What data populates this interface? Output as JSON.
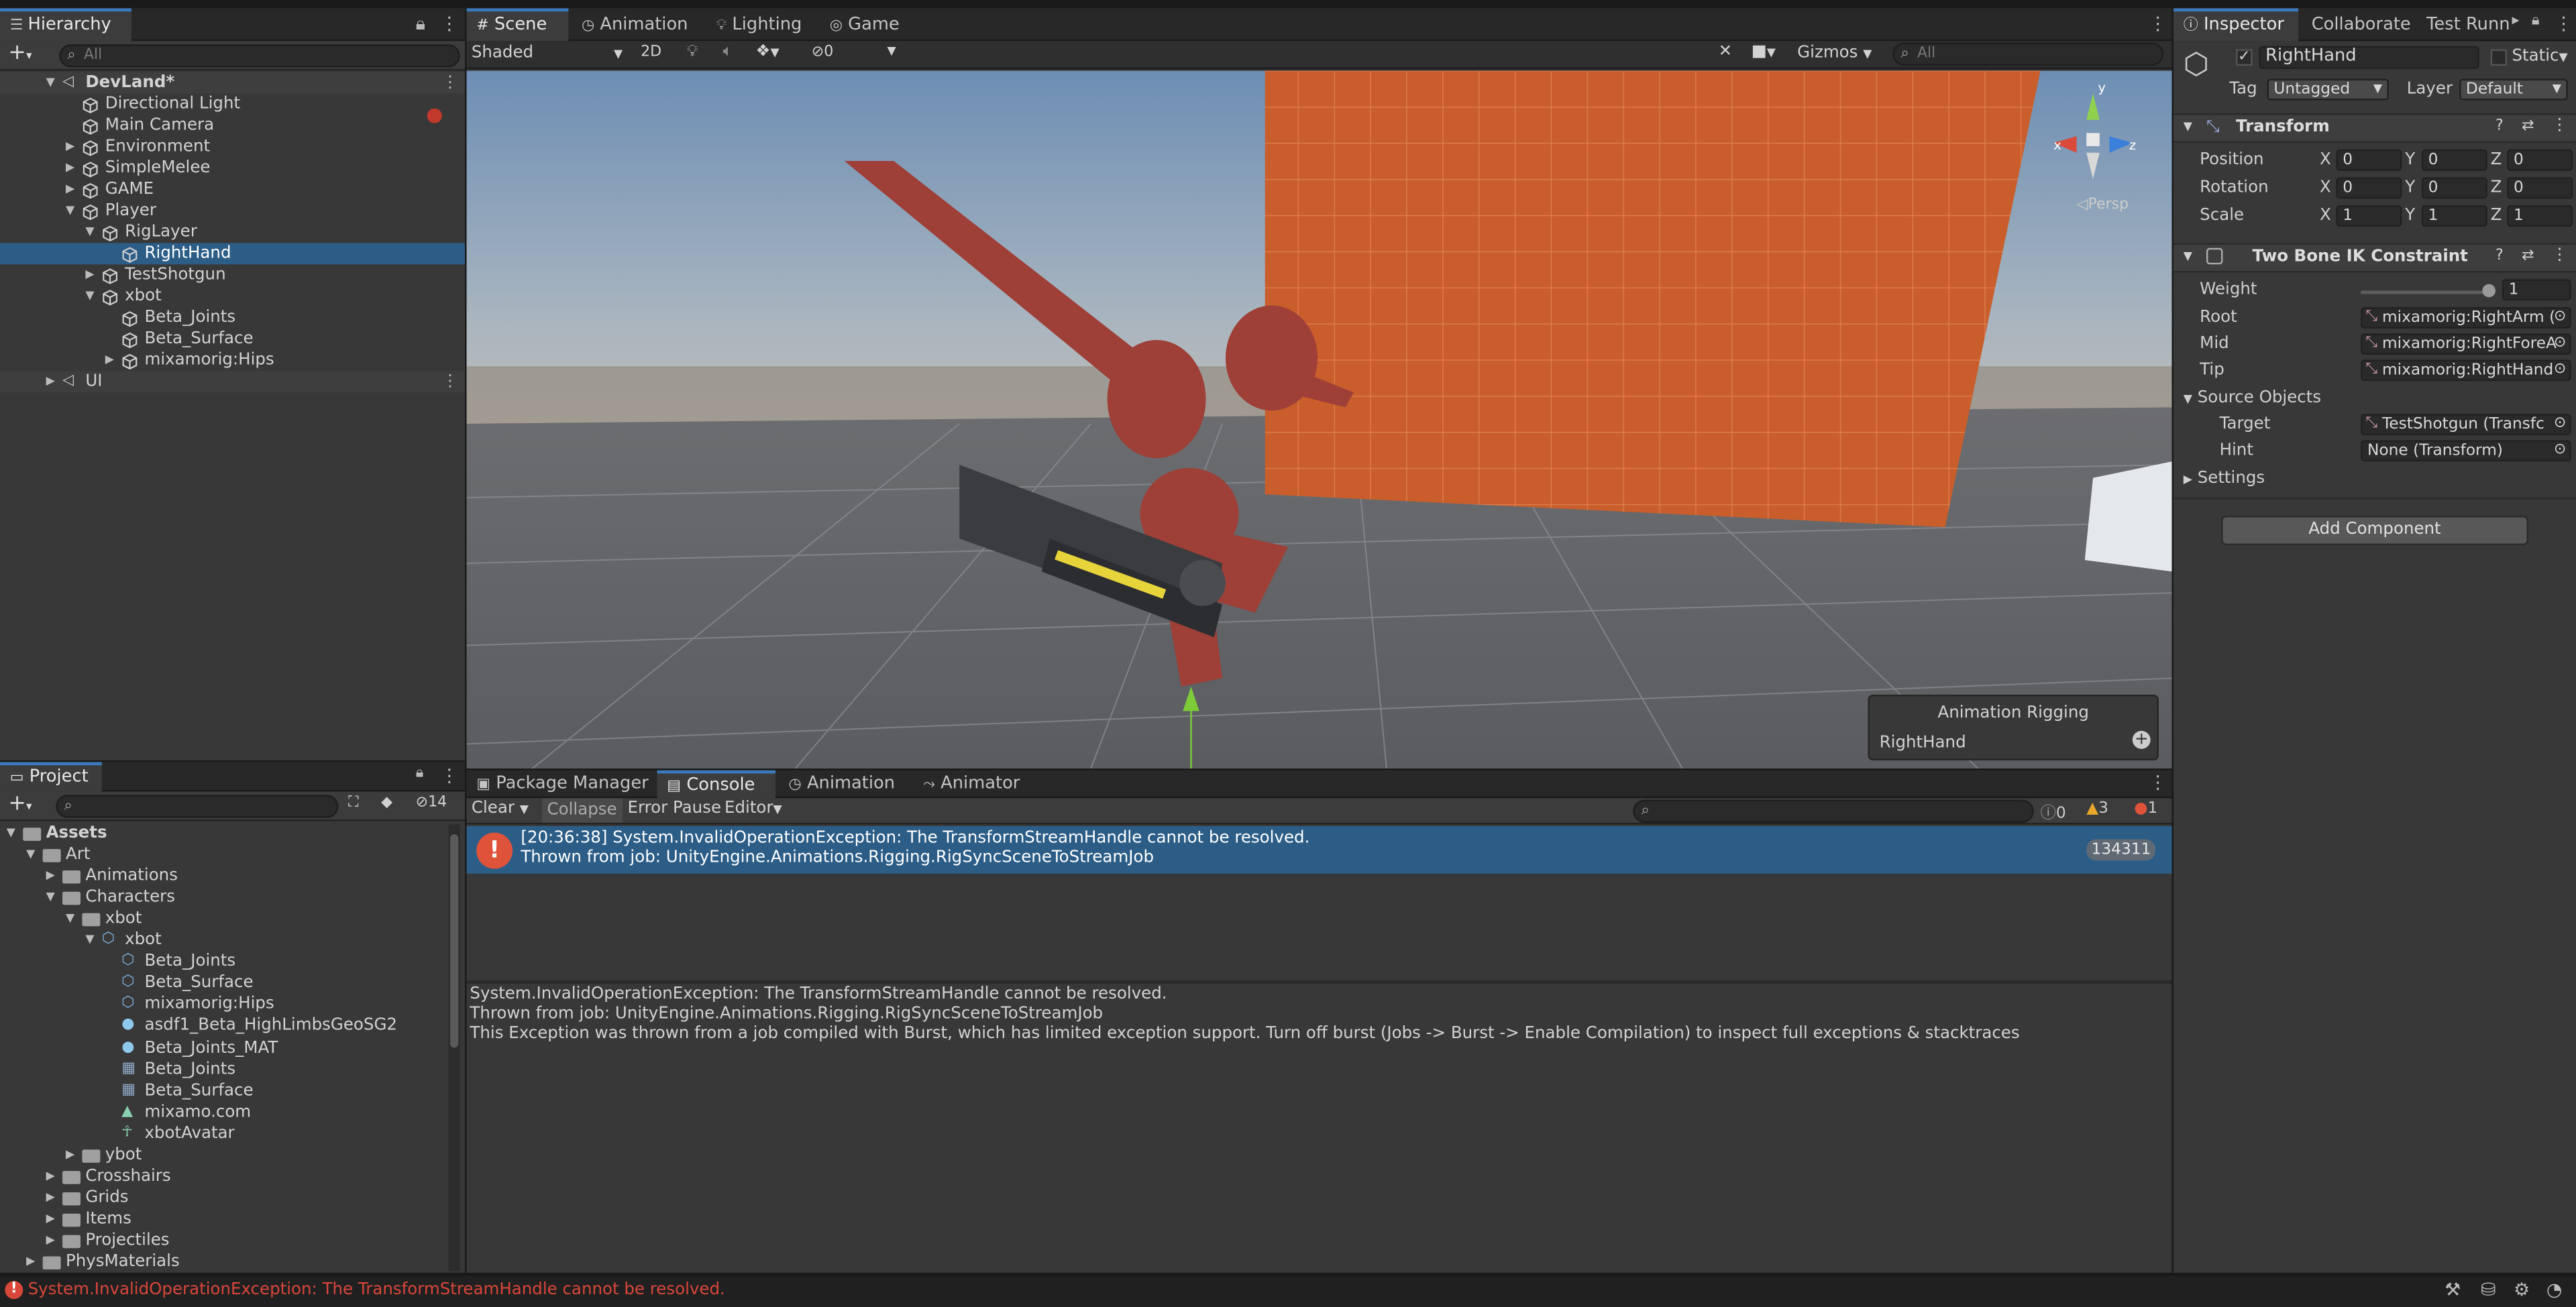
{
  "hierarchy": {
    "tab": "Hierarchy",
    "search_placeholder": "All",
    "scene": "DevLand*",
    "items": [
      {
        "label": "Directional Light",
        "depth": 1,
        "arrow": ""
      },
      {
        "label": "Main Camera",
        "depth": 1,
        "arrow": ""
      },
      {
        "label": "Environment",
        "depth": 1,
        "arrow": "▶"
      },
      {
        "label": "SimpleMelee",
        "depth": 1,
        "arrow": "▶"
      },
      {
        "label": "GAME",
        "depth": 1,
        "arrow": "▶"
      },
      {
        "label": "Player",
        "depth": 1,
        "arrow": "▼"
      },
      {
        "label": "RigLayer",
        "depth": 2,
        "arrow": "▼"
      },
      {
        "label": "RightHand",
        "depth": 3,
        "arrow": ""
      },
      {
        "label": "TestShotgun",
        "depth": 2,
        "arrow": "▶"
      },
      {
        "label": "xbot",
        "depth": 2,
        "arrow": "▼"
      },
      {
        "label": "Beta_Joints",
        "depth": 3,
        "arrow": ""
      },
      {
        "label": "Beta_Surface",
        "depth": 3,
        "arrow": ""
      },
      {
        "label": "mixamorig:Hips",
        "depth": 3,
        "arrow": "▶"
      }
    ],
    "ui_scene": "UI"
  },
  "scene_view": {
    "tabs": [
      "Scene",
      "Animation",
      "Lighting",
      "Game"
    ],
    "shading": "Shaded",
    "mode_2d": "2D",
    "hidden_count": "0",
    "gizmos": "Gizmos",
    "search_placeholder": "All",
    "persp": "Persp",
    "axis_x": "x",
    "axis_y": "y",
    "axis_z": "z",
    "overlay_title": "Animation Rigging",
    "overlay_item": "RightHand"
  },
  "inspector": {
    "tabs": [
      "Inspector",
      "Collaborate",
      "Test Runn"
    ],
    "object_name": "RightHand",
    "static_label": "Static",
    "tag_label": "Tag",
    "tag_value": "Untagged",
    "layer_label": "Layer",
    "layer_value": "Default",
    "transform": {
      "title": "Transform",
      "rows": [
        {
          "label": "Position",
          "x": "0",
          "y": "0",
          "z": "0"
        },
        {
          "label": "Rotation",
          "x": "0",
          "y": "0",
          "z": "0"
        },
        {
          "label": "Scale",
          "x": "1",
          "y": "1",
          "z": "1"
        }
      ]
    },
    "ik": {
      "title": "Two Bone IK Constraint",
      "weight_label": "Weight",
      "weight_value": "1",
      "root_label": "Root",
      "root_value": "mixamorig:RightArm (",
      "mid_label": "Mid",
      "mid_value": "mixamorig:RightForeA",
      "tip_label": "Tip",
      "tip_value": "mixamorig:RightHand",
      "source_label": "Source Objects",
      "target_label": "Target",
      "target_value": "TestShotgun (Transfc",
      "hint_label": "Hint",
      "hint_value": "None (Transform)",
      "settings_label": "Settings"
    },
    "add_component": "Add Component"
  },
  "project": {
    "tab": "Project",
    "hidden_count": "14",
    "tree": [
      {
        "label": "Assets",
        "depth": 0,
        "arrow": "▼",
        "icon": "folder",
        "bold": true
      },
      {
        "label": "Art",
        "depth": 1,
        "arrow": "▼",
        "icon": "folder"
      },
      {
        "label": "Animations",
        "depth": 2,
        "arrow": "▶",
        "icon": "folder"
      },
      {
        "label": "Characters",
        "depth": 2,
        "arrow": "▼",
        "icon": "folder"
      },
      {
        "label": "xbot",
        "depth": 3,
        "arrow": "▼",
        "icon": "folder"
      },
      {
        "label": "xbot",
        "depth": 4,
        "arrow": "▼",
        "icon": "model"
      },
      {
        "label": "Beta_Joints",
        "depth": 5,
        "arrow": "",
        "icon": "mesh"
      },
      {
        "label": "Beta_Surface",
        "depth": 5,
        "arrow": "",
        "icon": "mesh"
      },
      {
        "label": "mixamorig:Hips",
        "depth": 5,
        "arrow": "",
        "icon": "mesh"
      },
      {
        "label": "asdf1_Beta_HighLimbsGeoSG2",
        "depth": 5,
        "arrow": "",
        "icon": "material"
      },
      {
        "label": "Beta_Joints_MAT",
        "depth": 5,
        "arrow": "",
        "icon": "material"
      },
      {
        "label": "Beta_Joints",
        "depth": 5,
        "arrow": "",
        "icon": "grid"
      },
      {
        "label": "Beta_Surface",
        "depth": 5,
        "arrow": "",
        "icon": "grid"
      },
      {
        "label": "mixamo.com",
        "depth": 5,
        "arrow": "",
        "icon": "anim"
      },
      {
        "label": "xbotAvatar",
        "depth": 5,
        "arrow": "",
        "icon": "avatar"
      },
      {
        "label": "ybot",
        "depth": 3,
        "arrow": "▶",
        "icon": "folder"
      },
      {
        "label": "Crosshairs",
        "depth": 2,
        "arrow": "▶",
        "icon": "folder"
      },
      {
        "label": "Grids",
        "depth": 2,
        "arrow": "▶",
        "icon": "folder"
      },
      {
        "label": "Items",
        "depth": 2,
        "arrow": "▶",
        "icon": "folder"
      },
      {
        "label": "Projectiles",
        "depth": 2,
        "arrow": "▶",
        "icon": "folder"
      },
      {
        "label": "PhysMaterials",
        "depth": 1,
        "arrow": "▶",
        "icon": "folder"
      }
    ]
  },
  "console": {
    "tabs": [
      "Package Manager",
      "Console",
      "Animation",
      "Animator"
    ],
    "clear": "Clear",
    "collapse": "Collapse",
    "error_pause": "Error Pause",
    "editor": "Editor",
    "log_count": "0",
    "warn_count": "3",
    "error_count": "1",
    "entry_line1": "[20:36:38] System.InvalidOperationException: The TransformStreamHandle cannot be resolved.",
    "entry_line2": "Thrown from job: UnityEngine.Animations.Rigging.RigSyncSceneToStreamJob",
    "entry_count": "134311",
    "detail_line1": "System.InvalidOperationException: The TransformStreamHandle cannot be resolved.",
    "detail_line2": "Thrown from job: UnityEngine.Animations.Rigging.RigSyncSceneToStreamJob",
    "detail_line3": "This Exception was thrown from a job compiled with Burst, which has limited exception support. Turn off burst (Jobs -> Burst -> Enable Compilation) to inspect full exceptions & stacktraces"
  },
  "status": {
    "message": "System.InvalidOperationException: The TransformStreamHandle cannot be resolved."
  },
  "colors": {
    "selection": "#2c5d87",
    "accent": "#3a79bb",
    "error": "#e0533b",
    "warning": "#e8a92a",
    "status_text": "#d9463a"
  }
}
